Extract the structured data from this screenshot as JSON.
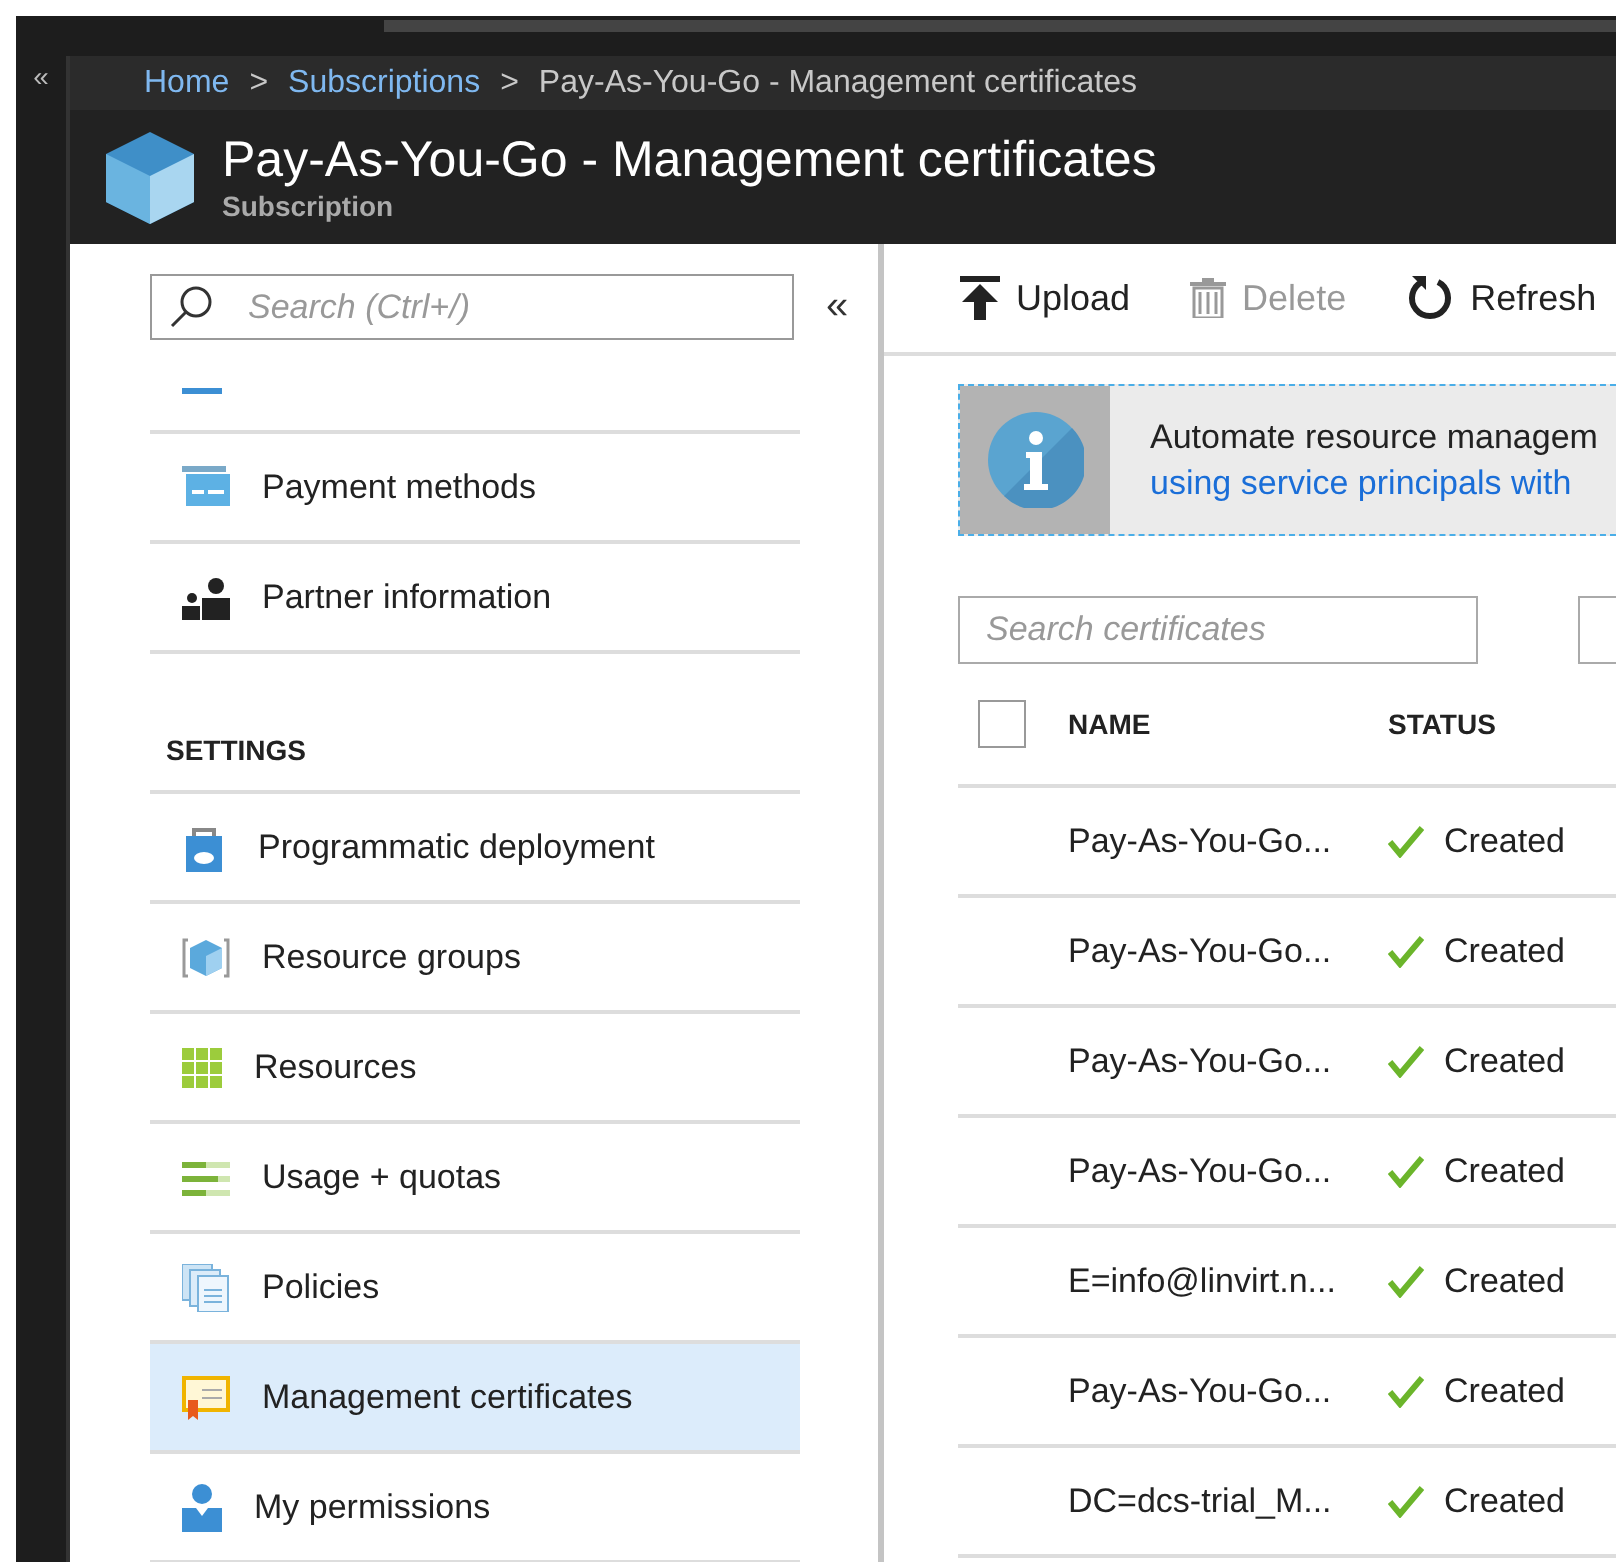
{
  "collapse_glyph": "«",
  "breadcrumb": [
    {
      "label": "Home",
      "link": true
    },
    {
      "label": "Subscriptions",
      "link": true
    },
    {
      "label": "Pay-As-You-Go - Management certificates",
      "link": false
    }
  ],
  "breadcrumb_separator": ">",
  "header": {
    "title": "Pay-As-You-Go - Management certificates",
    "subtitle": "Subscription"
  },
  "sidebar": {
    "search_placeholder": "Search (Ctrl+/)",
    "collapse_glyph": "«",
    "items": [
      {
        "kind": "partial"
      },
      {
        "kind": "item",
        "label": "Payment methods",
        "selected": false
      },
      {
        "kind": "item",
        "label": "Partner information",
        "selected": false
      },
      {
        "kind": "heading",
        "label": "SETTINGS"
      },
      {
        "kind": "item",
        "label": "Programmatic deployment",
        "selected": false
      },
      {
        "kind": "item",
        "label": "Resource groups",
        "selected": false
      },
      {
        "kind": "item",
        "label": "Resources",
        "selected": false
      },
      {
        "kind": "item",
        "label": "Usage + quotas",
        "selected": false
      },
      {
        "kind": "item",
        "label": "Policies",
        "selected": false
      },
      {
        "kind": "item",
        "label": "Management certificates",
        "selected": true
      },
      {
        "kind": "item",
        "label": "My permissions",
        "selected": false
      }
    ]
  },
  "toolbar": [
    {
      "label": "Upload",
      "disabled": false
    },
    {
      "label": "Delete",
      "disabled": true
    },
    {
      "label": "Refresh",
      "disabled": false
    }
  ],
  "info_banner": {
    "text": "Automate resource managem",
    "link": "using service principals with"
  },
  "search": {
    "placeholder": "Search certificates"
  },
  "table": {
    "columns": [
      "NAME",
      "STATUS"
    ],
    "select_all_checked": false,
    "rows": [
      {
        "name": "Pay-As-You-Go...",
        "status": "Created"
      },
      {
        "name": "Pay-As-You-Go...",
        "status": "Created"
      },
      {
        "name": "Pay-As-You-Go...",
        "status": "Created"
      },
      {
        "name": "Pay-As-You-Go...",
        "status": "Created"
      },
      {
        "name": "E=info@linvirt.n...",
        "status": "Created"
      },
      {
        "name": "Pay-As-You-Go...",
        "status": "Created"
      },
      {
        "name": "DC=dcs-trial_M...",
        "status": "Created"
      }
    ]
  }
}
